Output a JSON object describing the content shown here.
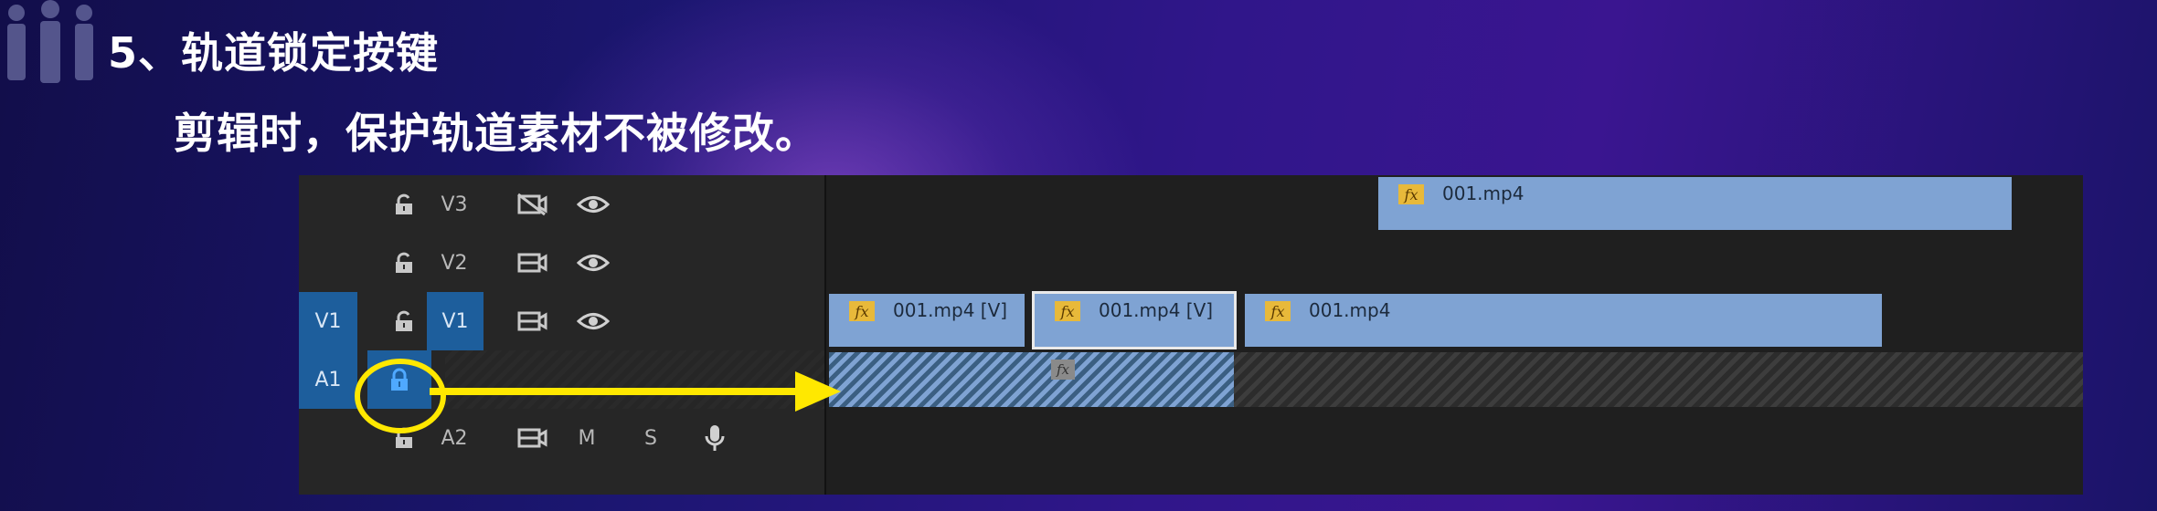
{
  "slide": {
    "title": "5、轨道锁定按键",
    "subtitle": "剪辑时，保护轨道素材不被修改。"
  },
  "colors": {
    "background": "#1b1670",
    "clip_video": "#7fa3d3",
    "fx_badge": "#e8b93a",
    "source_patch": "#1d5e9c",
    "annotation": "#ffe800"
  },
  "timeline": {
    "tracks": [
      {
        "id": "V3",
        "source": "",
        "target": "V3",
        "locked": false,
        "sync_icon": "toggle-output-off-icon",
        "visibility_icon": "eye-icon"
      },
      {
        "id": "V2",
        "source": "",
        "target": "V2",
        "locked": false,
        "sync_icon": "camera-icon",
        "visibility_icon": "eye-icon"
      },
      {
        "id": "V1",
        "source": "V1",
        "target": "V1",
        "locked": false,
        "sync_icon": "camera-icon",
        "visibility_icon": "eye-icon"
      },
      {
        "id": "A1",
        "source": "A1",
        "target": "",
        "locked": true
      },
      {
        "id": "A2",
        "source": "",
        "target": "A2",
        "locked": false,
        "sync_icon": "camera-icon",
        "mute": "M",
        "solo": "S",
        "voice_icon": "microphone-icon"
      }
    ],
    "clips": {
      "v3": [
        {
          "label": "001.mp4",
          "fx": "fx"
        }
      ],
      "v1": [
        {
          "label": "001.mp4 [V]",
          "fx": "fx"
        },
        {
          "label": "001.mp4 [V]",
          "fx": "fx",
          "selected": true
        },
        {
          "label": "001.mp4",
          "fx": "fx"
        }
      ],
      "a1": [
        {
          "fx": "fx"
        }
      ]
    }
  },
  "annotation": {
    "target": "A1 lock toggle",
    "shape": "circle-and-arrow"
  }
}
